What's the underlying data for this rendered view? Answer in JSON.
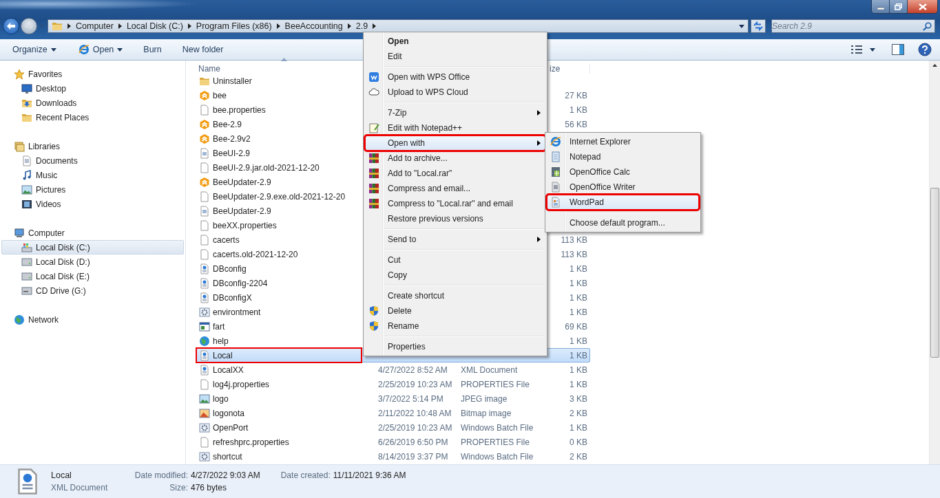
{
  "address": {
    "crumbs": [
      "Computer",
      "Local Disk (C:)",
      "Program Files (x86)",
      "BeeAccounting",
      "2.9"
    ]
  },
  "search": {
    "placeholder": "Search 2.9"
  },
  "toolbar": [
    {
      "label": "Organize",
      "dropdown": true
    },
    {
      "label": "Open",
      "dropdown": true,
      "kind": "ie"
    },
    {
      "label": "Burn",
      "dropdown": false
    },
    {
      "label": "New folder",
      "dropdown": false
    }
  ],
  "navigation": [
    {
      "label": "Favorites",
      "kind": "star",
      "selected": false,
      "children": [
        {
          "label": "Desktop",
          "kind": "desktop",
          "selected": false
        },
        {
          "label": "Downloads",
          "kind": "downloads",
          "selected": false
        },
        {
          "label": "Recent Places",
          "kind": "recent",
          "selected": false
        }
      ]
    },
    {
      "label": "Libraries",
      "kind": "library",
      "selected": false,
      "children": [
        {
          "label": "Documents",
          "kind": "documents",
          "selected": false
        },
        {
          "label": "Music",
          "kind": "music",
          "selected": false
        },
        {
          "label": "Pictures",
          "kind": "pictures",
          "selected": false
        },
        {
          "label": "Videos",
          "kind": "videos",
          "selected": false
        }
      ]
    },
    {
      "label": "Computer",
      "kind": "computer",
      "selected": false,
      "children": [
        {
          "label": "Local Disk (C:)",
          "kind": "diskc",
          "selected": true
        },
        {
          "label": "Local Disk (D:)",
          "kind": "disk",
          "selected": false
        },
        {
          "label": "Local Disk (E:)",
          "kind": "disk",
          "selected": false
        },
        {
          "label": "CD Drive (G:)",
          "kind": "cd",
          "selected": false
        }
      ]
    },
    {
      "label": "Network",
      "kind": "network",
      "selected": false
    }
  ],
  "columns": [
    {
      "label": "Name"
    },
    {
      "label": "ize"
    }
  ],
  "files": [
    {
      "name": "Uninstaller",
      "kind": "folder",
      "selected": false,
      "marked": false
    },
    {
      "name": "bee",
      "kind": "hex",
      "size": "27 KB",
      "selected": false,
      "marked": false
    },
    {
      "name": "bee.properties",
      "kind": "file",
      "size": "1 KB",
      "selected": false,
      "marked": false
    },
    {
      "name": "Bee-2.9",
      "kind": "hex",
      "size": "56 KB",
      "selected": false,
      "marked": false
    },
    {
      "name": "Bee-2.9v2",
      "kind": "hex",
      "selected": false,
      "marked": false
    },
    {
      "name": "BeeUI-2.9",
      "kind": "app",
      "selected": false,
      "marked": false
    },
    {
      "name": "BeeUI-2.9.jar.old-2021-12-20",
      "kind": "file",
      "selected": false,
      "marked": false
    },
    {
      "name": "BeeUpdater-2.9",
      "kind": "hex",
      "selected": false,
      "marked": false
    },
    {
      "name": "BeeUpdater-2.9.exe.old-2021-12-20",
      "kind": "file",
      "selected": false,
      "marked": false
    },
    {
      "name": "BeeUpdater-2.9",
      "kind": "app",
      "selected": false,
      "marked": false
    },
    {
      "name": "beeXX.properties",
      "kind": "file",
      "selected": false,
      "marked": false
    },
    {
      "name": "cacerts",
      "kind": "file",
      "size": "113 KB",
      "selected": false,
      "marked": false
    },
    {
      "name": "cacerts.old-2021-12-20",
      "kind": "file",
      "size": "113 KB",
      "selected": false,
      "marked": false
    },
    {
      "name": "DBconfig",
      "kind": "xml",
      "size": "1 KB",
      "selected": false,
      "marked": false
    },
    {
      "name": "DBconfig-2204",
      "kind": "xml",
      "size": "1 KB",
      "selected": false,
      "marked": false
    },
    {
      "name": "DBconfigX",
      "kind": "xml",
      "size": "1 KB",
      "selected": false,
      "marked": false
    },
    {
      "name": "environtment",
      "kind": "gear",
      "size": "1 KB",
      "selected": false,
      "marked": false
    },
    {
      "name": "fart",
      "kind": "window",
      "size": "69 KB",
      "selected": false,
      "marked": false
    },
    {
      "name": "help",
      "kind": "globe",
      "size": "1 KB",
      "selected": false,
      "marked": false
    },
    {
      "name": "Local",
      "kind": "xml",
      "size": "1 KB",
      "selected": true,
      "marked": true
    },
    {
      "name": "LocalXX",
      "kind": "xml",
      "date": "4/27/2022 8:52 AM",
      "type": "XML Document",
      "size": "1 KB",
      "selected": false,
      "marked": false
    },
    {
      "name": "log4j.properties",
      "kind": "file",
      "date": "2/25/2019 10:23 AM",
      "type": "PROPERTIES File",
      "size": "1 KB",
      "selected": false,
      "marked": false
    },
    {
      "name": "logo",
      "kind": "image",
      "date": "3/7/2022 5:14 PM",
      "type": "JPEG image",
      "size": "3 KB",
      "selected": false,
      "marked": false
    },
    {
      "name": "logonota",
      "kind": "bitmap",
      "date": "2/11/2022 10:48 AM",
      "type": "Bitmap image",
      "size": "2 KB",
      "selected": false,
      "marked": false
    },
    {
      "name": "OpenPort",
      "kind": "gear",
      "date": "2/25/2019 10:23 AM",
      "type": "Windows Batch File",
      "size": "1 KB",
      "selected": false,
      "marked": false
    },
    {
      "name": "refreshprc.properties",
      "kind": "file",
      "date": "6/26/2019 6:50 PM",
      "type": "PROPERTIES File",
      "size": "0 KB",
      "selected": false,
      "marked": false
    },
    {
      "name": "shortcut",
      "kind": "gear",
      "date": "8/14/2019 3:37 PM",
      "type": "Windows Batch File",
      "size": "2 KB",
      "selected": false,
      "marked": false
    }
  ],
  "context_menu": {
    "groups": [
      [
        {
          "label": "Open",
          "default": true,
          "submenu": false,
          "selected": false,
          "marked": false
        },
        {
          "label": "Edit",
          "default": false,
          "submenu": false,
          "selected": false,
          "marked": false
        }
      ],
      [
        {
          "label": "Open with WPS Office",
          "kind": "wps",
          "default": false,
          "submenu": false,
          "selected": false,
          "marked": false
        },
        {
          "label": "Upload to WPS Cloud",
          "kind": "cloud",
          "default": false,
          "submenu": false,
          "selected": false,
          "marked": false
        }
      ],
      [
        {
          "label": "7-Zip",
          "default": false,
          "submenu": true,
          "selected": false,
          "marked": false
        },
        {
          "label": "Edit with Notepad++",
          "kind": "npp",
          "default": false,
          "submenu": false,
          "selected": false,
          "marked": false
        },
        {
          "label": "Open with",
          "default": false,
          "submenu": true,
          "selected": true,
          "marked": true
        },
        {
          "label": "Add to archive...",
          "kind": "rar",
          "default": false,
          "submenu": false,
          "selected": false,
          "marked": false
        },
        {
          "label": "Add to \"Local.rar\"",
          "kind": "rar",
          "default": false,
          "submenu": false,
          "selected": false,
          "marked": false
        },
        {
          "label": "Compress and email...",
          "kind": "rar",
          "default": false,
          "submenu": false,
          "selected": false,
          "marked": false
        },
        {
          "label": "Compress to \"Local.rar\" and email",
          "kind": "rar",
          "default": false,
          "submenu": false,
          "selected": false,
          "marked": false
        },
        {
          "label": "Restore previous versions",
          "default": false,
          "submenu": false,
          "selected": false,
          "marked": false
        }
      ],
      [
        {
          "label": "Send to",
          "default": false,
          "submenu": true,
          "selected": false,
          "marked": false
        }
      ],
      [
        {
          "label": "Cut",
          "default": false,
          "submenu": false,
          "selected": false,
          "marked": false
        },
        {
          "label": "Copy",
          "default": false,
          "submenu": false,
          "selected": false,
          "marked": false
        }
      ],
      [
        {
          "label": "Create shortcut",
          "default": false,
          "submenu": false,
          "selected": false,
          "marked": false
        },
        {
          "label": "Delete",
          "kind": "shield",
          "default": false,
          "submenu": false,
          "selected": false,
          "marked": false
        },
        {
          "label": "Rename",
          "kind": "shield",
          "default": false,
          "submenu": false,
          "selected": false,
          "marked": false
        }
      ],
      [
        {
          "label": "Properties",
          "default": false,
          "submenu": false,
          "selected": false,
          "marked": false
        }
      ]
    ]
  },
  "open_with_menu": {
    "groups": [
      [
        {
          "label": "Internet Explorer",
          "kind": "ie",
          "selected": false,
          "marked": false
        },
        {
          "label": "Notepad",
          "kind": "notepad",
          "selected": false,
          "marked": false
        },
        {
          "label": "OpenOffice Calc",
          "kind": "calc",
          "selected": false,
          "marked": false
        },
        {
          "label": "OpenOffice Writer",
          "kind": "writer",
          "selected": false,
          "marked": false
        },
        {
          "label": "WordPad",
          "kind": "wordpad",
          "selected": true,
          "marked": true
        }
      ],
      [
        {
          "label": "Choose default program...",
          "selected": false,
          "marked": false
        }
      ]
    ]
  },
  "details": {
    "kind": "xml",
    "name": "Local",
    "type": "XML Document",
    "fields": [
      {
        "label": "Date modified:",
        "value": "4/27/2022 9:03 AM"
      },
      {
        "label": "Size:",
        "value": "476 bytes"
      },
      {
        "label": "Date created:",
        "value": "11/11/2021 9:36 AM"
      }
    ]
  }
}
